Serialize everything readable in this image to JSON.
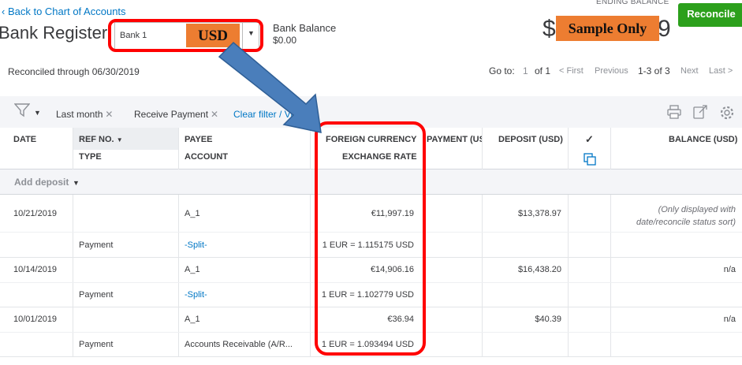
{
  "header": {
    "back_link": "Back to Chart of Accounts",
    "title": "Bank Register",
    "account_value": "Bank 1",
    "currency_tag": "USD",
    "bank_balance_label": "Bank Balance",
    "bank_balance_value": "$0.00",
    "ending_balance_label": "ENDING BALANCE",
    "ending_balance_prefix": "$",
    "ending_balance_suffix": "9",
    "sample_tag": "Sample Only",
    "reconcile_label": "Reconcile"
  },
  "status": {
    "reconciled_through": "Reconciled through 06/30/2019"
  },
  "pager": {
    "goto_label": "Go to:",
    "page": "1",
    "of_pages": "of 1",
    "first": "< First",
    "previous": "Previous",
    "range": "1-3 of 3",
    "next": "Next",
    "last": "Last >"
  },
  "filters": {
    "chips": [
      "Last month",
      "Receive Payment"
    ],
    "clear": "Clear filter / Vie"
  },
  "columns": {
    "date": "DATE",
    "ref_no": "REF NO.",
    "type": "TYPE",
    "payee": "PAYEE",
    "account": "ACCOUNT",
    "foreign_currency": "FOREIGN CURRENCY",
    "exchange_rate": "EXCHANGE RATE",
    "payment": "PAYMENT (US",
    "deposit": "DEPOSIT (USD)",
    "check": "✓",
    "balance": "BALANCE (USD)"
  },
  "add_deposit": "Add deposit",
  "rows": [
    {
      "date": "10/21/2019",
      "type": "Payment",
      "payee": "A_1",
      "account": "-Split-",
      "foreign_amount": "€11,997.19",
      "exchange_rate": "1 EUR = 1.115175 USD",
      "deposit": "$13,378.97",
      "balance_line1": "(Only displayed with",
      "balance_line2": "date/reconcile status sort)"
    },
    {
      "date": "10/14/2019",
      "type": "Payment",
      "payee": "A_1",
      "account": "-Split-",
      "foreign_amount": "€14,906.16",
      "exchange_rate": "1 EUR = 1.102779 USD",
      "deposit": "$16,438.20",
      "balance": "n/a"
    },
    {
      "date": "10/01/2019",
      "type": "Payment",
      "payee": "A_1",
      "account": "Accounts Receivable (A/R...",
      "foreign_amount": "€36.94",
      "exchange_rate": "1 EUR = 1.093494 USD",
      "deposit": "$40.39",
      "balance": "n/a"
    }
  ],
  "colors": {
    "link": "#0077c5",
    "reconcile": "#2ca01c",
    "annotation_red": "#ff0000",
    "annotation_orange": "#ed7d31",
    "arrow_blue": "#4a7ebb"
  }
}
